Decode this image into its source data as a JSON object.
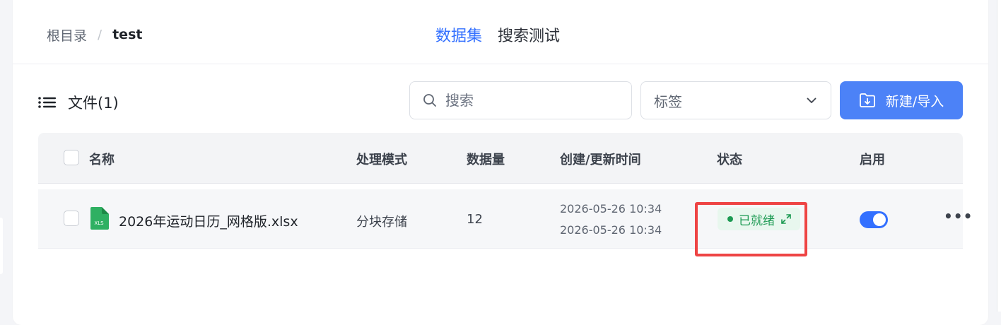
{
  "breadcrumb": {
    "root": "根目录",
    "separator": "/",
    "current": "test"
  },
  "tabs": [
    {
      "label": "数据集",
      "active": true
    },
    {
      "label": "搜索测试",
      "active": false
    }
  ],
  "files": {
    "title": "文件(1)"
  },
  "search": {
    "placeholder": "搜索",
    "value": ""
  },
  "tag_filter": {
    "selected": "标签"
  },
  "new_button": {
    "label": "新建/导入"
  },
  "table": {
    "columns": [
      "名称",
      "处理模式",
      "数据量",
      "创建/更新时间",
      "状态",
      "启用"
    ],
    "rows": [
      {
        "name": "2026年运动日历_网格版.xlsx",
        "file_type": "XLS",
        "mode": "分块存储",
        "count": "12",
        "created": "2026-05-26 10:34",
        "updated": "2026-05-26 10:34",
        "status": "已就绪",
        "enabled": true
      }
    ]
  },
  "colors": {
    "accent": "#3370ff",
    "primary_button": "#4c82f7",
    "status_green": "#1c9a52",
    "status_green_bg": "#e8f7ee",
    "highlight_red": "#ee4444"
  },
  "icons": [
    "list-icon",
    "search-icon",
    "chevron-down-icon",
    "import-folder-icon",
    "xls-file-icon",
    "expand-icon",
    "more-icon"
  ]
}
